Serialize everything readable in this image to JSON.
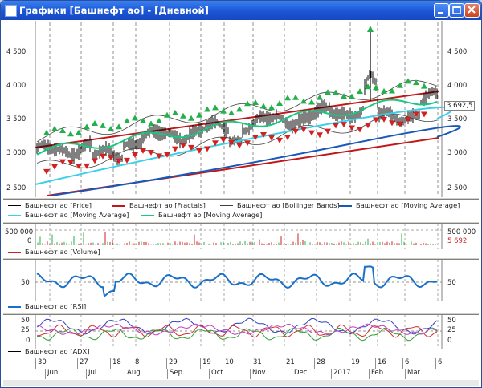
{
  "window": {
    "title": "Графики [Башнефт ао] - [Дневной]"
  },
  "colors": {
    "price": "#000000",
    "fractal_up": "#22b04a",
    "fractal_down": "#d42020",
    "channel": "#c01818",
    "ma_slow": "#3ad0e8",
    "ma_fast": "#18c880",
    "ma_long": "#1a58b8",
    "volume_bar": "#cc2222",
    "rsi": "#1a70c8"
  },
  "price_panel": {
    "y_ticks": [
      "4 500",
      "4 000",
      "3 500",
      "3 000",
      "2 500"
    ],
    "last_value": "3 692,5",
    "legend": [
      {
        "label": "Башнефт ао [Price]",
        "color": "#000000"
      },
      {
        "label": "Башнефт ао [Fractals]",
        "color": "#c01818"
      },
      {
        "label": "Башнефт ао [Bollinger Bands]",
        "color": "#404040"
      },
      {
        "label": "Башнефт ао [Moving Average]",
        "color": "#1a58b8"
      },
      {
        "label": "Башнефт ао [Moving Average]",
        "color": "#3ad0e8"
      },
      {
        "label": "Башнефт ао [Moving Average]",
        "color": "#18c880"
      }
    ]
  },
  "volume_panel": {
    "y_tick": "500 000",
    "y_tick_zero": "0",
    "right_tick": "500 000",
    "last_value": "5 692",
    "legend": "Башнефт ао [Volume]"
  },
  "rsi_panel": {
    "y_tick": "50",
    "right_tick": "50",
    "legend": "Башнефт ао [RSI]"
  },
  "adx_panel": {
    "y_ticks": [
      "50",
      "25",
      "0"
    ],
    "right_ticks": [
      "50",
      "25",
      "0"
    ],
    "legend": "Башнефт ао [ADX]"
  },
  "time_axis": {
    "days": [
      "30",
      "27",
      "18",
      "8",
      "29",
      "19",
      "10",
      "31",
      "21",
      "28",
      "19",
      "16",
      "6",
      "6"
    ],
    "months": [
      "Jun",
      "Jul",
      "Aug",
      "Sep",
      "Oct",
      "Nov",
      "Dec",
      "2017",
      "Feb",
      "Mar"
    ]
  }
}
